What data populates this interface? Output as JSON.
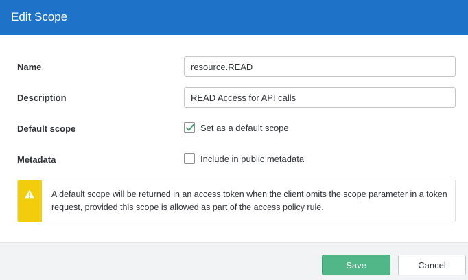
{
  "dialog": {
    "title": "Edit Scope"
  },
  "form": {
    "name": {
      "label": "Name",
      "value": "resource.READ"
    },
    "description": {
      "label": "Description",
      "value": "READ Access for API calls"
    },
    "default_scope": {
      "label": "Default scope",
      "checkbox_label": "Set as a default scope",
      "checked": true
    },
    "metadata": {
      "label": "Metadata",
      "checkbox_label": "Include in public metadata",
      "checked": false
    }
  },
  "warning": {
    "icon": "warning-triangle-icon",
    "text": "A default scope will be returned in an access token when the client omits the scope parameter in a token request, provided this scope is allowed as part of the access policy rule."
  },
  "footer": {
    "save_label": "Save",
    "cancel_label": "Cancel"
  },
  "colors": {
    "header": "#1e72c7",
    "save_button": "#52b788",
    "warning_stripe": "#f2cd0e",
    "checkmark": "#3a9c6a"
  }
}
